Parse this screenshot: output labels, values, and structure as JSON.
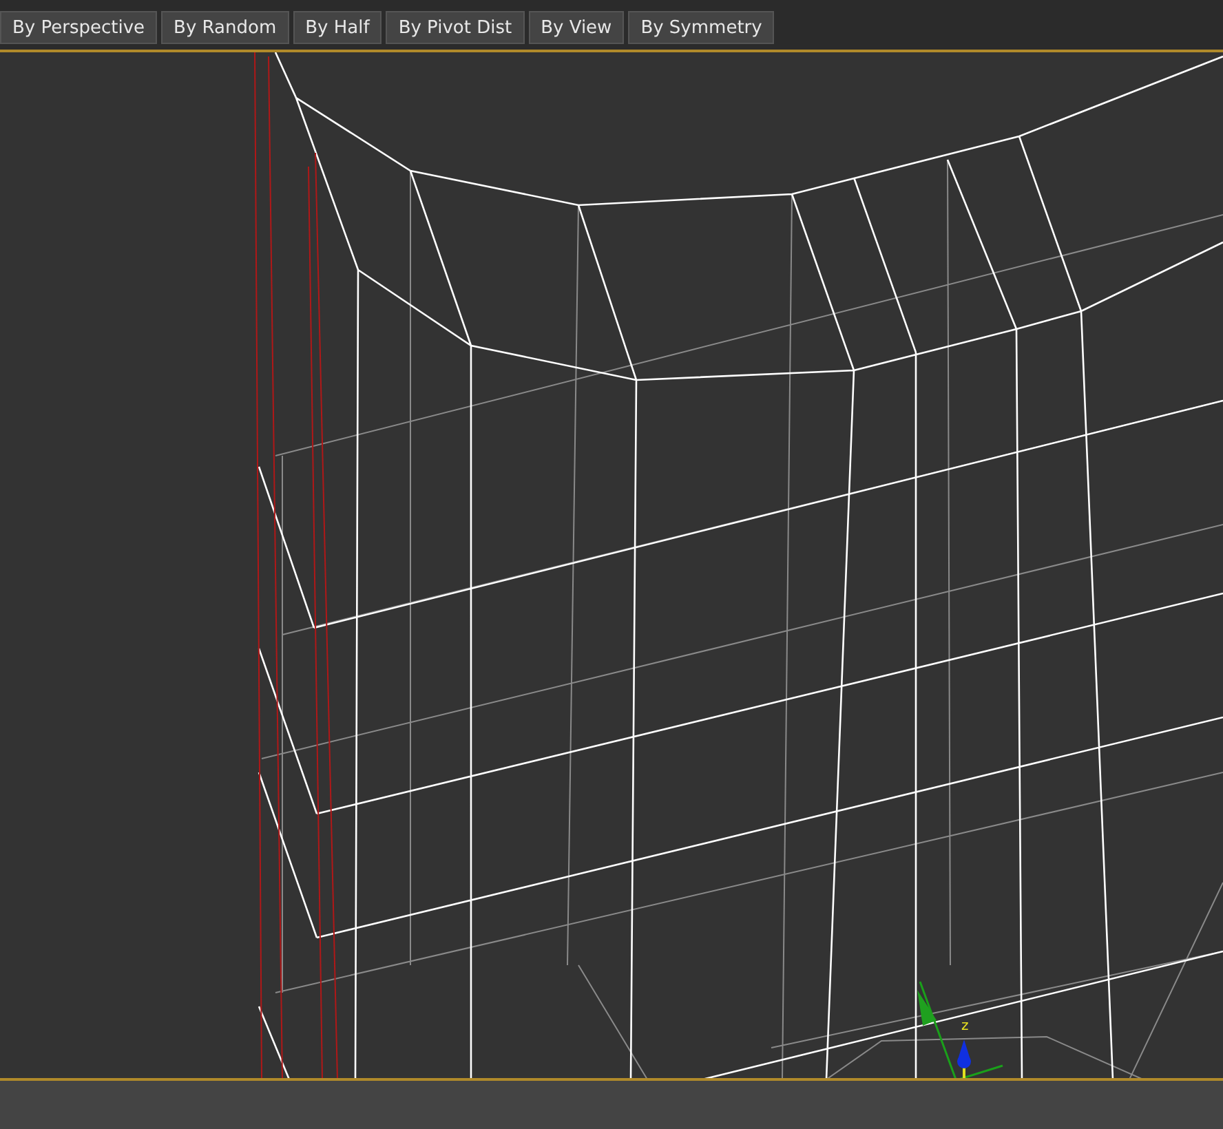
{
  "toolbar": {
    "buttons": [
      {
        "label": "By Perspective"
      },
      {
        "label": "By Random"
      },
      {
        "label": "By Half"
      },
      {
        "label": "By Pivot Dist"
      },
      {
        "label": "By View"
      },
      {
        "label": "By Symmetry"
      }
    ]
  },
  "viewport": {
    "gizmo": {
      "axis_label": "z"
    }
  }
}
